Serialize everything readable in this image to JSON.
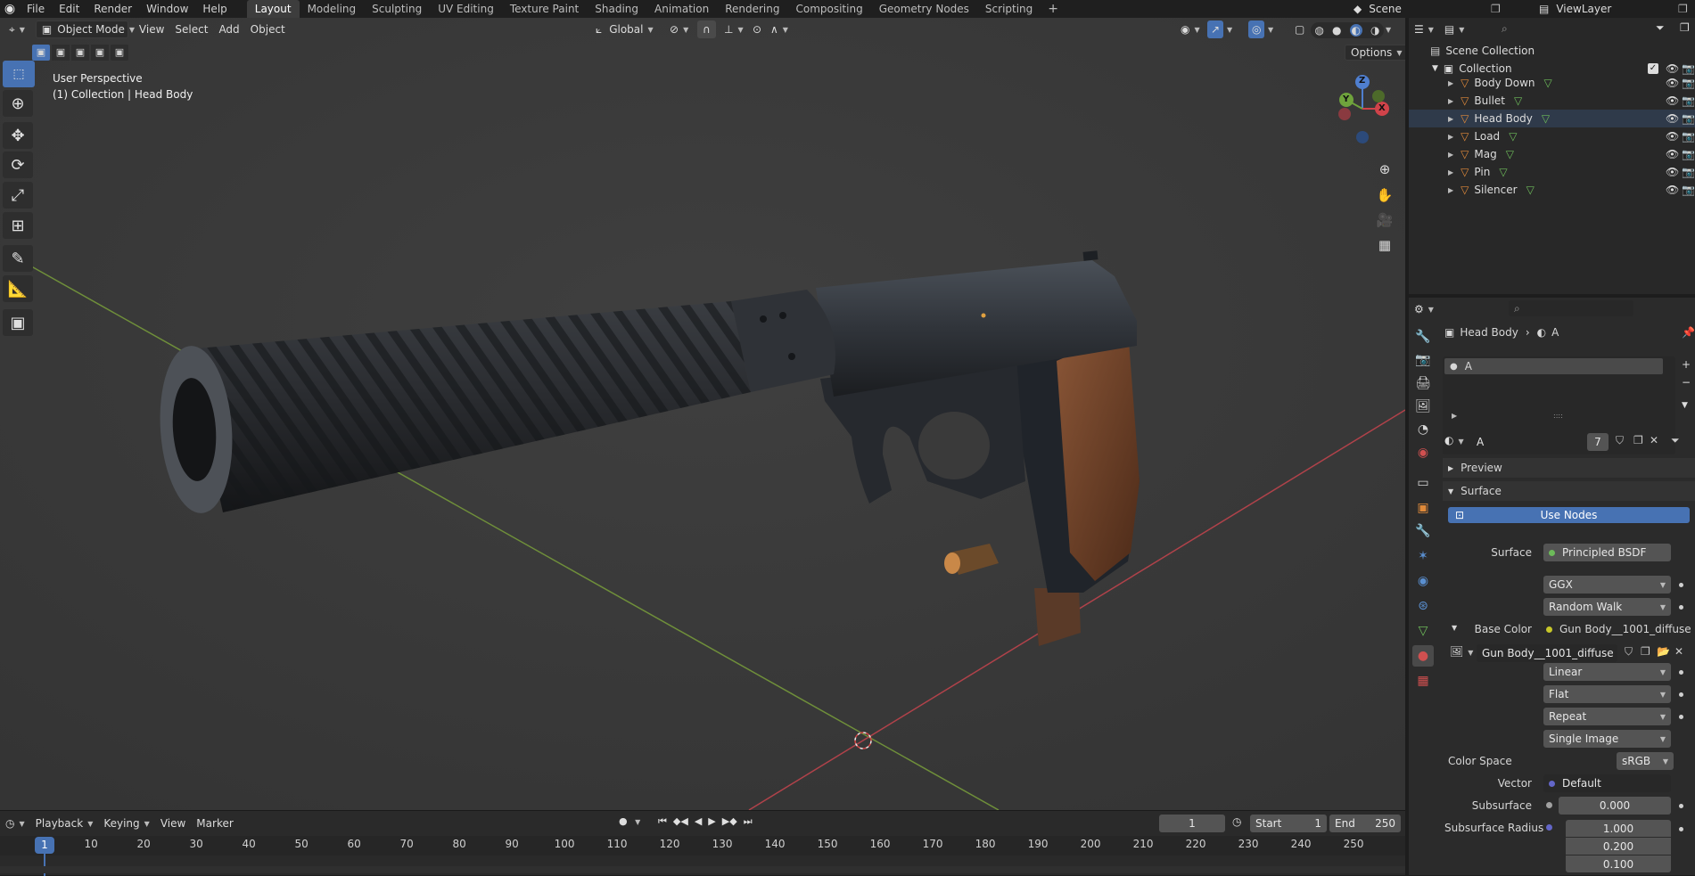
{
  "menubar": {
    "items": [
      "File",
      "Edit",
      "Render",
      "Window",
      "Help"
    ],
    "workspaces": [
      "Layout",
      "Modeling",
      "Sculpting",
      "UV Editing",
      "Texture Paint",
      "Shading",
      "Animation",
      "Rendering",
      "Compositing",
      "Geometry Nodes",
      "Scripting"
    ],
    "active_workspace": "Layout",
    "scene": "Scene",
    "view_layer": "ViewLayer"
  },
  "viewport": {
    "mode": "Object Mode",
    "menus": [
      "View",
      "Select",
      "Add",
      "Object"
    ],
    "orientation": "Global",
    "options_label": "Options",
    "perspective_label": "User Perspective",
    "collection_label": "(1) Collection | Head Body"
  },
  "gizmo": {
    "z": "Z",
    "y": "Y",
    "x": "X"
  },
  "timeline": {
    "menus": [
      "Playback",
      "Keying",
      "View",
      "Marker"
    ],
    "current_frame": "1",
    "start_label": "Start",
    "start": "1",
    "end_label": "End",
    "end": "250",
    "ticks": [
      "1",
      "10",
      "20",
      "30",
      "40",
      "50",
      "60",
      "70",
      "80",
      "90",
      "100",
      "110",
      "120",
      "130",
      "140",
      "150",
      "160",
      "170",
      "180",
      "190",
      "200",
      "210",
      "220",
      "230",
      "240",
      "250"
    ]
  },
  "outliner": {
    "scene_collection": "Scene Collection",
    "collection": "Collection",
    "objects": [
      "Body Down",
      "Bullet",
      "Head Body",
      "Load",
      "Mag",
      "Pin",
      "Silencer"
    ],
    "selected": "Head Body"
  },
  "properties": {
    "breadcrumb_object": "Head Body",
    "breadcrumb_material": "A",
    "slot_name": "A",
    "material_name": "A",
    "user_count": "7",
    "preview_label": "Preview",
    "surface_label": "Surface",
    "use_nodes": "Use Nodes",
    "surface_field_label": "Surface",
    "surface_shader": "Principled BSDF",
    "distribution": "GGX",
    "subsurface_method": "Random Walk",
    "base_color_label": "Base Color",
    "base_color_value": "Gun Body__1001_diffuse",
    "image_name": "Gun Body__1001_diffuse",
    "interpolation": "Linear",
    "projection": "Flat",
    "extension": "Repeat",
    "source": "Single Image",
    "color_space_label": "Color Space",
    "color_space": "sRGB",
    "vector_label": "Vector",
    "vector_value": "Default",
    "subsurface_label": "Subsurface",
    "subsurface_value": "0.000",
    "subsurface_radius_label": "Subsurface Radius",
    "subsurface_radius": [
      "1.000",
      "0.200",
      "0.100"
    ]
  },
  "colors": {
    "accent": "#4772b3",
    "viewport_bg": "#3a3a3a",
    "panel_bg": "#2b2b2b",
    "x_axis": "#c0454a",
    "y_axis": "#7aa33c",
    "frame_marker": "#4772b3"
  }
}
